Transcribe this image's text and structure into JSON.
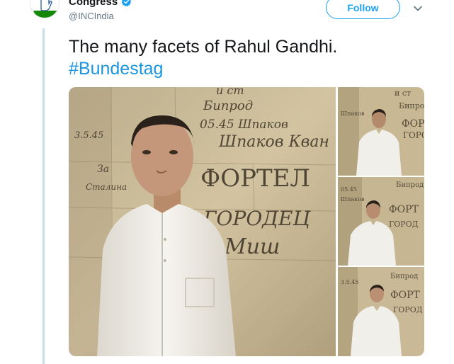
{
  "user": {
    "display_name": "Congress",
    "handle": "@INCIndia",
    "avatar_icon": "hand-logo-icon",
    "verified_icon": "verified-badge-icon"
  },
  "actions": {
    "follow_label": "Follow",
    "menu_icon": "chevron-down-icon"
  },
  "tweet": {
    "text": "The many facets of Rahul Gandhi.",
    "hashtag": "#Bundestag"
  },
  "media": {
    "photos": [
      {
        "name": "main-photo"
      },
      {
        "name": "thumbnail-photo-1"
      },
      {
        "name": "thumbnail-photo-2"
      },
      {
        "name": "thumbnail-photo-3"
      }
    ],
    "wall_graffiti": [
      "и ст",
      "Бипрод",
      "05.45",
      "Шпаков",
      "Кван",
      "ФОРТЕЛ",
      "ГОРОДЕЦ",
      "Миш",
      "За",
      "Сталина",
      "3.5.45"
    ]
  },
  "colors": {
    "accent": "#1da1f2",
    "hashtag": "#1b95e0",
    "thread_line": "#c4dbe8",
    "wall": "#c9b998",
    "shirt": "#f3f1ec"
  }
}
